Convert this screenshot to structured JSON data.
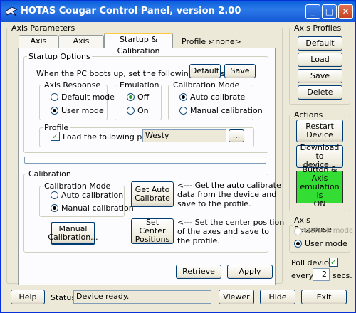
{
  "window": {
    "title": "HOTAS Cougar Control Panel, version 2.00"
  },
  "axis_parameters": {
    "legend": "Axis Parameters",
    "tabs": [
      "Axis Setup",
      "Axis Shaping",
      "Startup & Calibration"
    ],
    "profile_label": "Profile :",
    "profile_value": "<none>",
    "startup": {
      "legend": "Startup Options",
      "instruction": "When the PC boots up, set the following options:",
      "default_btn": "Default",
      "save_btn": "Save",
      "axis_response": {
        "legend": "Axis Response",
        "options": [
          "Default mode",
          "User mode"
        ],
        "selected": "User mode"
      },
      "emulation": {
        "legend": "Emulation",
        "options": [
          "Off",
          "On"
        ],
        "selected": "Off"
      },
      "calib_mode": {
        "legend": "Calibration Mode",
        "options": [
          "Auto calibrate",
          "Manual calibration"
        ],
        "selected": "Auto calibrate"
      },
      "profile": {
        "legend": "Profile",
        "checkbox_label": "Load the following profile:",
        "checked": true,
        "value": "Westy",
        "browse": "..."
      }
    },
    "calibration": {
      "legend": "Calibration",
      "mode_legend": "Calibration Mode",
      "options": [
        "Auto calibration",
        "Manual calibration"
      ],
      "selected": "Manual calibration",
      "manual_btn_line1": "Manual",
      "manual_btn_line2": "Calibration...",
      "get_auto_line1": "Get Auto",
      "get_auto_line2": "Calibrate",
      "get_auto_desc": [
        "<--- Get the auto calibrate",
        "data from the device and",
        "save to the profile."
      ],
      "set_center_line1": "Set Center",
      "set_center_line2": "Positions",
      "set_center_desc": [
        "<--- Set the center position",
        "of the axes and save to",
        "the profile."
      ]
    },
    "retrieve_btn": "Retrieve",
    "apply_btn": "Apply"
  },
  "axis_profiles": {
    "legend": "Axis Profiles",
    "buttons": [
      "Default",
      "Load",
      "Save",
      "Delete"
    ]
  },
  "actions": {
    "legend": "Actions",
    "restart_line1": "Restart",
    "restart_line2": "Device",
    "download_line1": "Download",
    "download_line2": "to device...",
    "emulation_line1": "Button & Axis",
    "emulation_line2": "emulation is",
    "emulation_line3": "ON",
    "emulation_color": "#33dd33"
  },
  "axis_response_side": {
    "legend": "Axis Response",
    "options": [
      "Default mode",
      "User mode"
    ],
    "selected": "User mode"
  },
  "poll": {
    "label": "Poll device",
    "checked": true,
    "every_label": "every",
    "value": "2",
    "unit": "secs."
  },
  "bottom": {
    "help": "Help",
    "status_label": "Status:",
    "status_value": "Device ready.",
    "viewer": "Viewer",
    "hide": "Hide",
    "exit": "Exit"
  }
}
